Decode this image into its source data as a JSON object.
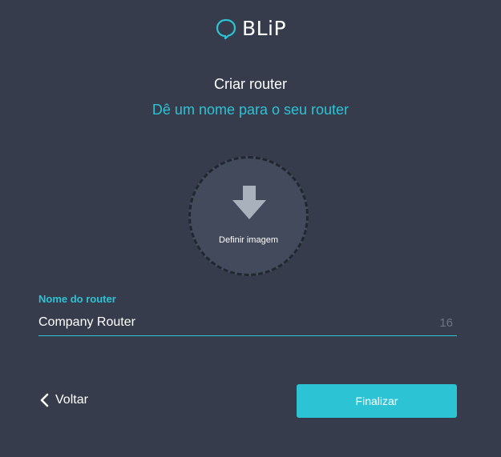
{
  "brand": {
    "logo_text": "BLiP",
    "logo_icon": "chat-bubble-icon",
    "accent_color": "#2cc3d5"
  },
  "header": {
    "title": "Criar router",
    "subtitle": "Dê um nome para o seu router"
  },
  "avatar": {
    "label": "Definir imagem",
    "icon": "arrow-down-icon"
  },
  "name_field": {
    "label": "Nome do router",
    "value": "Company Router",
    "remaining_chars": "16"
  },
  "footer": {
    "back_label": "Voltar",
    "back_icon": "chevron-left-icon",
    "finish_label": "Finalizar"
  }
}
